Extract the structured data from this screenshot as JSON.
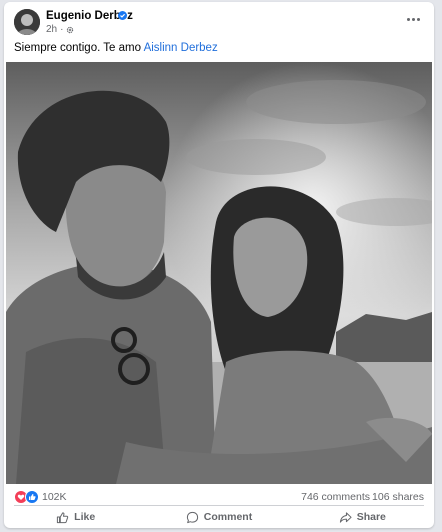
{
  "post": {
    "author": "Eugenio Derbez",
    "time": "2h",
    "caption_text": "Siempre contigo. Te amo ",
    "caption_mention": "Aislinn Derbez"
  },
  "icons": {
    "verified": "verified-badge-icon",
    "audience": "settings-gear-icon",
    "more": "more-options-icon",
    "reactions": [
      "love-reaction-icon",
      "like-reaction-icon"
    ],
    "like": "thumbs-up-icon",
    "comment": "comment-bubble-icon",
    "share": "share-arrow-icon"
  },
  "stats": {
    "reactions": "102K",
    "comments": "746 comments",
    "shares": "106 shares"
  },
  "actions": {
    "like": "Like",
    "comment": "Comment",
    "share": "Share"
  },
  "colors": {
    "link": "#216fdb",
    "verified": "#1877f2",
    "love": "#f33e58",
    "like": "#1877f2"
  }
}
